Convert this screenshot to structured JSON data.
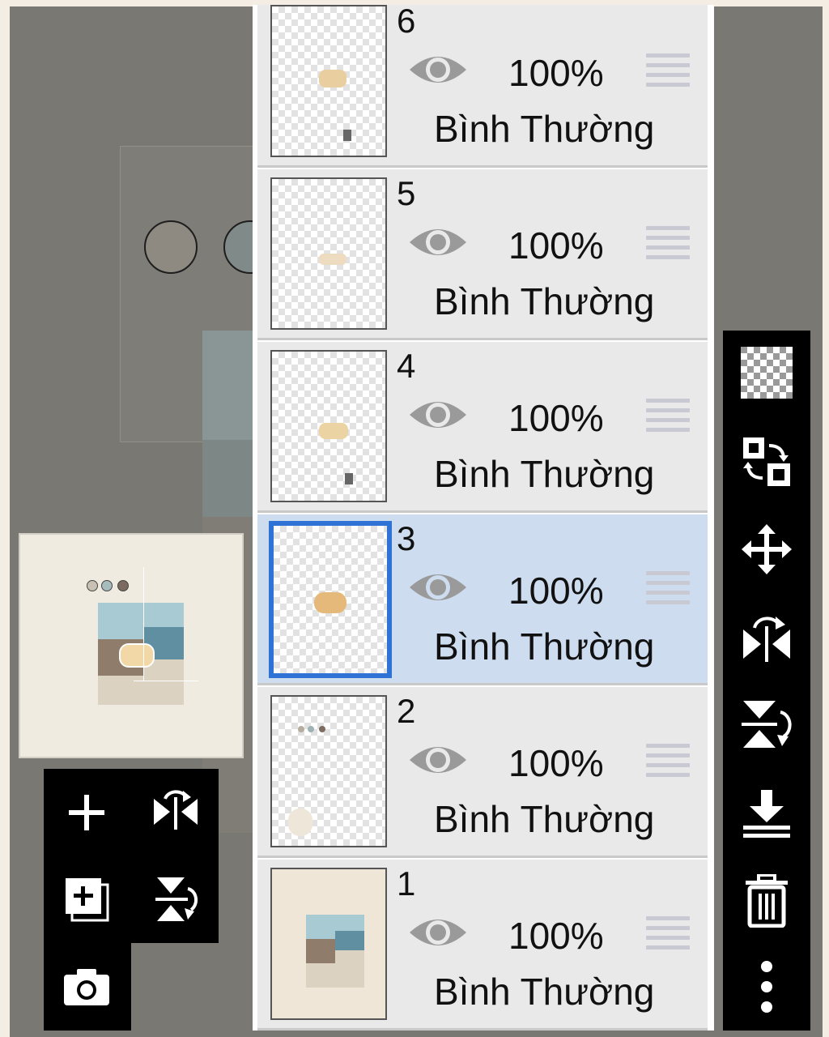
{
  "layers": [
    {
      "number": "6",
      "opacity": "100%",
      "blend_mode": "Bình Thường",
      "selected": false
    },
    {
      "number": "5",
      "opacity": "100%",
      "blend_mode": "Bình Thường",
      "selected": false
    },
    {
      "number": "4",
      "opacity": "100%",
      "blend_mode": "Bình Thường",
      "selected": false
    },
    {
      "number": "3",
      "opacity": "100%",
      "blend_mode": "Bình Thường",
      "selected": true
    },
    {
      "number": "2",
      "opacity": "100%",
      "blend_mode": "Bình Thường",
      "selected": false
    },
    {
      "number": "1",
      "opacity": "100%",
      "blend_mode": "Bình Thường",
      "selected": false
    }
  ],
  "left_toolbar": [
    "add-layer-icon",
    "flip-horizontal-icon",
    "add-layer-copy-icon",
    "flip-vertical-icon",
    "camera-icon"
  ],
  "right_toolbar": [
    "transparency-icon",
    "swap-layers-icon",
    "move-icon",
    "flip-horizontal-icon",
    "flip-vertical-icon",
    "merge-down-icon",
    "trash-icon",
    "more-options-icon"
  ],
  "colors": {
    "selected_row": "#cddcee",
    "selected_border": "#2f73d6",
    "row_background": "#e9e9e9",
    "toolbar_background": "#000000",
    "canvas_dim": "#7a7873"
  }
}
